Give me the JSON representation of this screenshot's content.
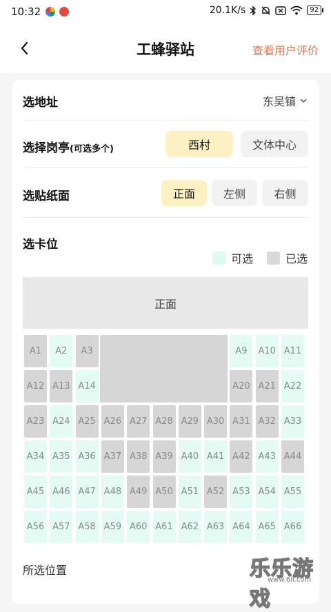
{
  "status_bar": {
    "time": "10:32",
    "network_speed": "20.1K/s",
    "battery": "92",
    "icons": [
      "app-colorful-icon",
      "app-red-icon",
      "bluetooth-icon",
      "mute-bell-icon",
      "sim-x-icon",
      "wifi-icon",
      "battery-icon"
    ]
  },
  "nav": {
    "title": "工蜂驿站",
    "action": "查看用户评价",
    "back_icon": "chevron-left-icon",
    "action_color": "#e8774f"
  },
  "form": {
    "address": {
      "label": "选地址",
      "value": "东吴镇"
    },
    "kiosk": {
      "label": "选择岗亭",
      "note": "(可选多个)",
      "options": [
        {
          "label": "西村",
          "selected": true
        },
        {
          "label": "文体中心",
          "selected": false
        }
      ]
    },
    "surface": {
      "label": "选贴纸面",
      "options": [
        {
          "label": "正面",
          "selected": true
        },
        {
          "label": "左侧",
          "selected": false
        },
        {
          "label": "右侧",
          "selected": false
        }
      ]
    },
    "slot": {
      "label": "选卡位",
      "legend_available": "可选",
      "legend_taken": "已选",
      "front_label": "正面"
    }
  },
  "colors": {
    "available": "#e3fbf2",
    "taken": "#d6d6d6",
    "selected_chip": "#fdf0c2",
    "accent": "#e8774f"
  },
  "seats": [
    {
      "id": "A1",
      "status": "taken"
    },
    {
      "id": "A2",
      "status": "available"
    },
    {
      "id": "A3",
      "status": "taken"
    },
    {
      "id": "A9",
      "status": "available"
    },
    {
      "id": "A10",
      "status": "available"
    },
    {
      "id": "A11",
      "status": "available"
    },
    {
      "id": "A12",
      "status": "taken"
    },
    {
      "id": "A13",
      "status": "taken"
    },
    {
      "id": "A14",
      "status": "available"
    },
    {
      "id": "A20",
      "status": "taken"
    },
    {
      "id": "A21",
      "status": "taken"
    },
    {
      "id": "A22",
      "status": "available"
    },
    {
      "id": "A23",
      "status": "taken"
    },
    {
      "id": "A24",
      "status": "available"
    },
    {
      "id": "A25",
      "status": "taken"
    },
    {
      "id": "A26",
      "status": "taken"
    },
    {
      "id": "A27",
      "status": "taken"
    },
    {
      "id": "A28",
      "status": "taken"
    },
    {
      "id": "A29",
      "status": "taken"
    },
    {
      "id": "A30",
      "status": "taken"
    },
    {
      "id": "A31",
      "status": "taken"
    },
    {
      "id": "A32",
      "status": "taken"
    },
    {
      "id": "A33",
      "status": "available"
    },
    {
      "id": "A34",
      "status": "available"
    },
    {
      "id": "A35",
      "status": "available"
    },
    {
      "id": "A36",
      "status": "available"
    },
    {
      "id": "A37",
      "status": "taken"
    },
    {
      "id": "A38",
      "status": "taken"
    },
    {
      "id": "A39",
      "status": "taken"
    },
    {
      "id": "A40",
      "status": "available"
    },
    {
      "id": "A41",
      "status": "available"
    },
    {
      "id": "A42",
      "status": "taken"
    },
    {
      "id": "A43",
      "status": "available"
    },
    {
      "id": "A44",
      "status": "taken"
    },
    {
      "id": "A45",
      "status": "available"
    },
    {
      "id": "A46",
      "status": "available"
    },
    {
      "id": "A47",
      "status": "available"
    },
    {
      "id": "A48",
      "status": "available"
    },
    {
      "id": "A49",
      "status": "taken"
    },
    {
      "id": "A50",
      "status": "taken"
    },
    {
      "id": "A51",
      "status": "available"
    },
    {
      "id": "A52",
      "status": "taken"
    },
    {
      "id": "A53",
      "status": "available"
    },
    {
      "id": "A54",
      "status": "available"
    },
    {
      "id": "A55",
      "status": "available"
    },
    {
      "id": "A56",
      "status": "available"
    },
    {
      "id": "A57",
      "status": "available"
    },
    {
      "id": "A58",
      "status": "available"
    },
    {
      "id": "A59",
      "status": "available"
    },
    {
      "id": "A60",
      "status": "available"
    },
    {
      "id": "A61",
      "status": "available"
    },
    {
      "id": "A62",
      "status": "available"
    },
    {
      "id": "A63",
      "status": "available"
    },
    {
      "id": "A64",
      "status": "available"
    },
    {
      "id": "A65",
      "status": "available"
    },
    {
      "id": "A66",
      "status": "available"
    }
  ],
  "selected_positions_label": "所选位置",
  "watermark": {
    "text": "乐乐游戏",
    "url": "www.6ll.com"
  }
}
